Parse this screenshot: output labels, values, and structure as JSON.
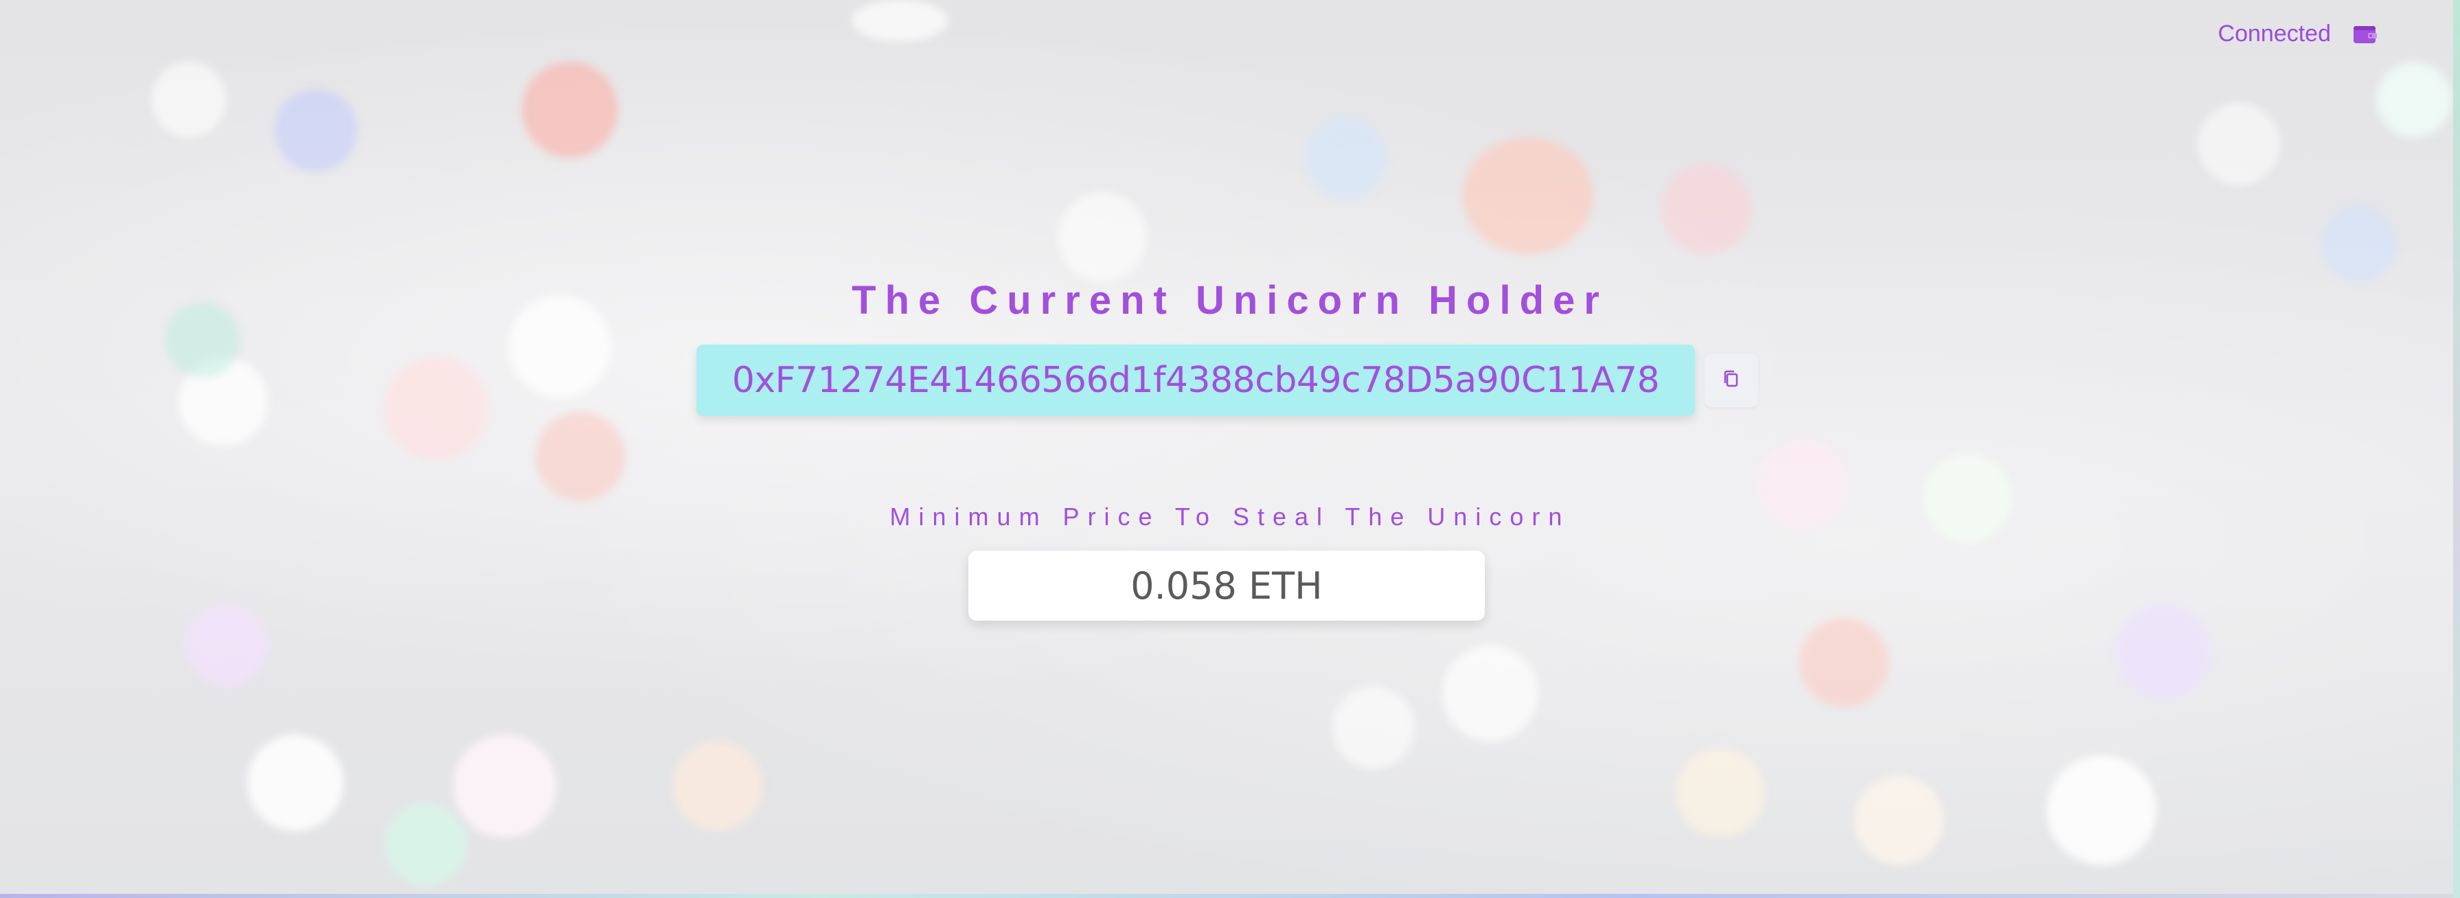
{
  "header": {
    "status_label": "Connected",
    "wallet_icon": "wallet-icon"
  },
  "main": {
    "title": "The Current Unicorn Holder",
    "holder_address": "0xF71274E41466566d1f4388cb49c78D5a90C11A78",
    "copy_icon": "copy-icon",
    "price_label": "Minimum Price To Steal The Unicorn",
    "price_value": "0.058 ETH"
  },
  "colors": {
    "accent": "#a24fdc",
    "address_bg": "#abeff1",
    "price_text": "#5a5a5a"
  }
}
